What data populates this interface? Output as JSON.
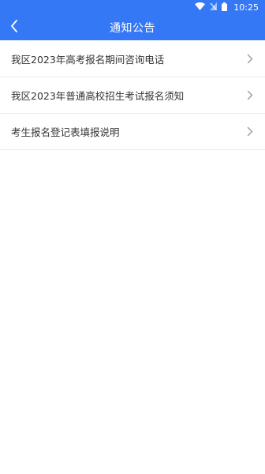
{
  "status_bar": {
    "time": "10:25",
    "icons": [
      "wifi-icon",
      "signal-icon",
      "battery-icon"
    ]
  },
  "header": {
    "title": "通知公告",
    "back_icon": "chevron-left-icon",
    "background": "#3478f6"
  },
  "notices": [
    {
      "title": "我区2023年高考报名期间咨询电话"
    },
    {
      "title": "我区2023年普通高校招生考试报名须知"
    },
    {
      "title": "考生报名登记表填报说明"
    }
  ],
  "colors": {
    "accent": "#3478f6",
    "text": "#333333",
    "divider": "#ececec",
    "chevron": "#9a9a9a"
  }
}
